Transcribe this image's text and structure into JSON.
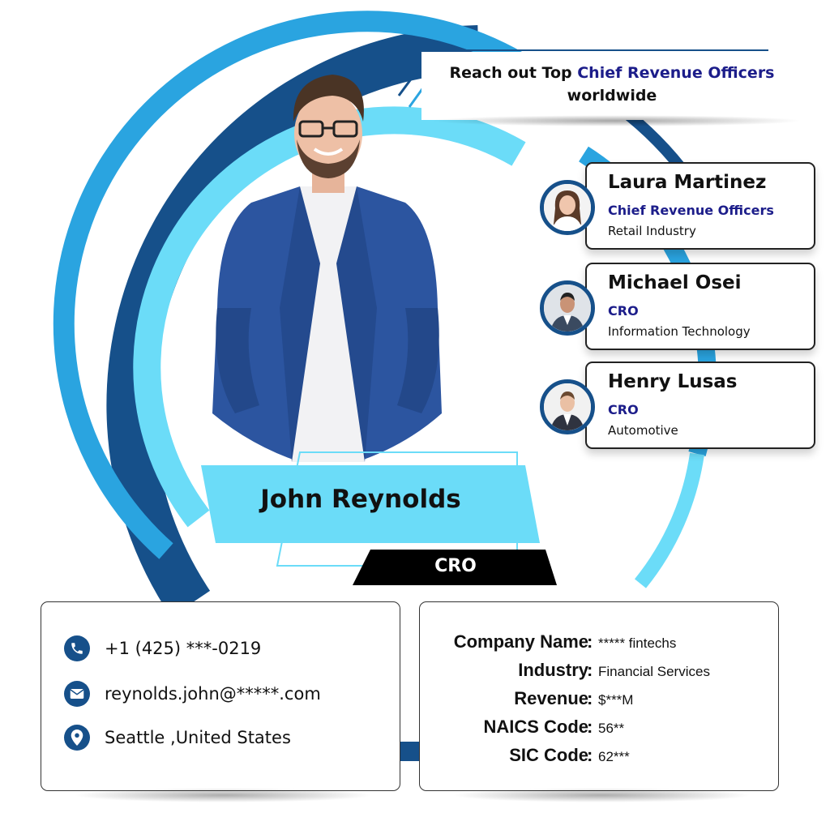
{
  "headline": {
    "part1": "Reach out Top ",
    "accent": "Chief Revenue Officers",
    "part2": "worldwide"
  },
  "featured": {
    "name": "John Reynolds",
    "role": "CRO"
  },
  "profiles": [
    {
      "name": "Laura Martinez",
      "title": "Chief Revenue Officers",
      "industry": "Retail Industry"
    },
    {
      "name": "Michael Osei",
      "title": "CRO",
      "industry": "Information Technology"
    },
    {
      "name": "Henry Lusas",
      "title": "CRO",
      "industry": "Automotive"
    }
  ],
  "contact": {
    "phone": "+1 (425) ***-0219",
    "email": "reynolds.john@*****.com",
    "location": "Seattle ,United States",
    "icons": [
      "phone-icon",
      "mail-icon",
      "location-pin-icon"
    ]
  },
  "company": {
    "rows": [
      {
        "label": "Company Name",
        "value": "***** fintechs"
      },
      {
        "label": "Industry",
        "value": "Financial Services"
      },
      {
        "label": "Revenue",
        "value": "$***M"
      },
      {
        "label": "NAICS Code",
        "value": "56**"
      },
      {
        "label": "SIC Code",
        "value": "62***"
      }
    ],
    "separator": ":"
  },
  "colors": {
    "navy": "#16508a",
    "accent_text": "#1c1d8a",
    "light_blue": "#6bdcf8",
    "mid_blue": "#2aa4e0",
    "role_bg": "#000000"
  }
}
